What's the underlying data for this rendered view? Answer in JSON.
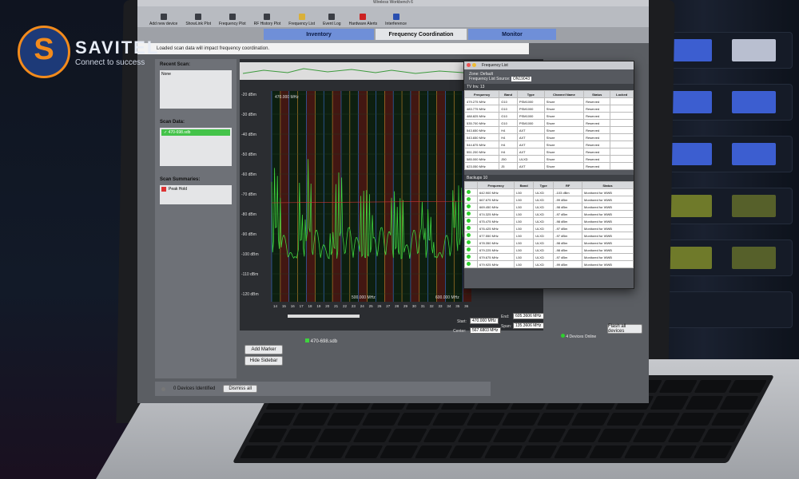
{
  "logo": {
    "name": "SAVITEL",
    "tagline": "Connect to success"
  },
  "window_title": "Wireless Workbench 6",
  "toolbar": [
    "Add new device",
    "ShowLink Plot",
    "Frequency Plot",
    "RF History Plot",
    "Frequency List",
    "Event Log",
    "Hardware Alerts",
    "Interference"
  ],
  "tabs": {
    "inventory": "Inventory",
    "coordination": "Frequency Coordination",
    "monitor": "Monitor"
  },
  "warning": "Loaded scan data will impact frequency coordination.",
  "sidebar": {
    "recent_scan_label": "Recent Scan:",
    "recent_scan_value": "None",
    "scan_data_label": "Scan Data:",
    "scan_file": "470-698.sdb",
    "scan_summaries_label": "Scan Summaries:",
    "peak_hold": "Peak Hold"
  },
  "chart": {
    "y_ticks": [
      "-20 dBm",
      "-30 dBm",
      "-40 dBm",
      "-50 dBm",
      "-60 dBm",
      "-70 dBm",
      "-80 dBm",
      "-90 dBm",
      "-100 dBm",
      "-110 dBm",
      "-120 dBm"
    ],
    "x_label_left": "470.000 MHz",
    "x_label_mid": "500.000 MHz",
    "x_label_right": "600.000 MHz",
    "channels": [
      "14",
      "15",
      "16",
      "17",
      "18",
      "19",
      "20",
      "21",
      "22",
      "23",
      "24",
      "25",
      "26",
      "27",
      "28",
      "29",
      "30",
      "31",
      "32",
      "33",
      "34",
      "35",
      "36"
    ],
    "legend_file": "470-698.sdb",
    "start_label": "Start:",
    "start_value": "470.000 MHz",
    "end_label": "End:",
    "end_value": "605.3606 MHz",
    "center_label": "Center:",
    "center_value": "567.6803 MHz",
    "span_label": "Span:",
    "span_value": "135.3606 MHz"
  },
  "buttons": {
    "add_marker": "Add Marker",
    "hide_sidebar": "Hide Sidebar",
    "dismiss_all": "Dismiss all",
    "flash_all": "Flash all devices"
  },
  "status": {
    "devices_identified": "0 Devices Identified",
    "devices_online": "4 Devices Online"
  },
  "dialog": {
    "title": "Frequency List",
    "zone_label": "Zone:",
    "zone_value": "Default",
    "source_label": "Frequency List Source:",
    "source_value": "ON19043",
    "section1_title": "TV Inv. 13",
    "table1_headers": [
      "Frequency",
      "Band",
      "Type",
      "Channel Name",
      "Status",
      "Locked"
    ],
    "table1_rows": [
      [
        "479.275 MHz",
        "G10",
        "PSM1000",
        "Shure",
        "Reserved",
        ""
      ],
      [
        "483.775 MHz",
        "G10",
        "PSM1000",
        "Shure",
        "Reserved",
        ""
      ],
      [
        "488.825 MHz",
        "G10",
        "PSM1000",
        "Shure",
        "Reserved",
        ""
      ],
      [
        "535.700 MHz",
        "G10",
        "PSM1000",
        "Shure",
        "Reserved",
        ""
      ],
      [
        "543.650 MHz",
        "H4",
        "AXT",
        "Shure",
        "Reserved",
        ""
      ],
      [
        "543.650 MHz",
        "H4",
        "AXT",
        "Shure",
        "Reserved",
        ""
      ],
      [
        "544.875 MHz",
        "H4",
        "AXT",
        "Shure",
        "Reserved",
        ""
      ],
      [
        "551.200 MHz",
        "H4",
        "AXT",
        "Shure",
        "Reserved",
        ""
      ],
      [
        "585.000 MHz",
        "J50",
        "ULXD",
        "Shure",
        "Reserved",
        ""
      ],
      [
        "623.050 MHz",
        "J5",
        "AXT",
        "Shure",
        "Reserved",
        ""
      ]
    ],
    "section2_title": "Backups 10",
    "table2_headers": [
      "",
      "Frequency",
      "Band",
      "Type",
      "RF",
      "Status"
    ],
    "table2_rows": [
      [
        "",
        "642.900 MHz",
        "L50",
        "ULXD",
        "-103 dBm",
        "Monitored for WWB"
      ],
      [
        "",
        "667.675 MHz",
        "L50",
        "ULXD",
        "-99 dBm",
        "Monitored for WWB"
      ],
      [
        "",
        "669.450 MHz",
        "L50",
        "ULXD",
        "-98 dBm",
        "Monitored for WWB"
      ],
      [
        "",
        "674.325 MHz",
        "L50",
        "ULXD",
        "-97 dBm",
        "Monitored for WWB"
      ],
      [
        "",
        "675.475 MHz",
        "L50",
        "ULXD",
        "-98 dBm",
        "Monitored for WWB"
      ],
      [
        "",
        "676.425 MHz",
        "L50",
        "ULXD",
        "-97 dBm",
        "Monitored for WWB"
      ],
      [
        "",
        "677.550 MHz",
        "L50",
        "ULXD",
        "-97 dBm",
        "Monitored for WWB"
      ],
      [
        "",
        "678.350 MHz",
        "L50",
        "ULXD",
        "-98 dBm",
        "Monitored for WWB"
      ],
      [
        "",
        "679.225 MHz",
        "L50",
        "ULXD",
        "-98 dBm",
        "Monitored for WWB"
      ],
      [
        "",
        "679.675 MHz",
        "L50",
        "ULXD",
        "-97 dBm",
        "Monitored for WWB"
      ],
      [
        "",
        "679.925 MHz",
        "L50",
        "ULXD",
        "-99 dBm",
        "Monitored for WWB"
      ]
    ]
  }
}
